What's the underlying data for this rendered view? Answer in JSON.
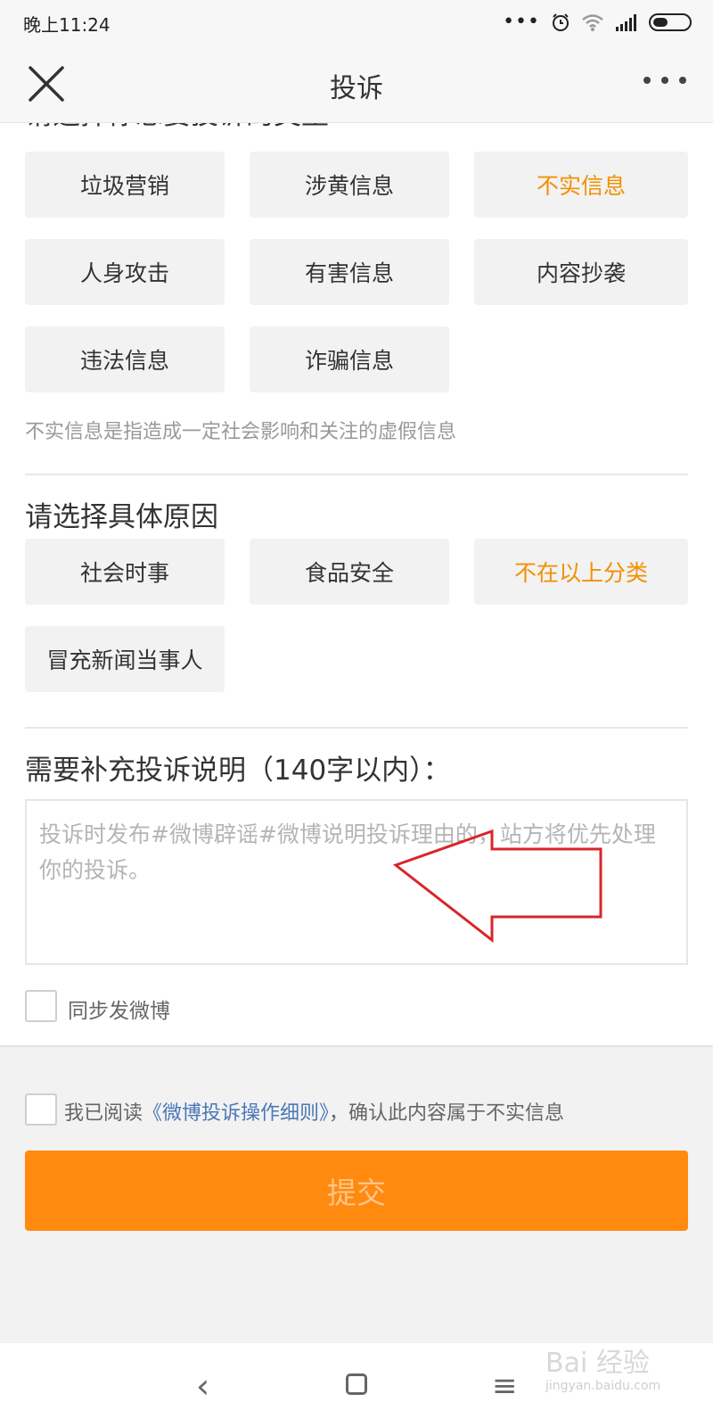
{
  "status_bar": {
    "time": "晚上11:24",
    "dots": "•••"
  },
  "nav": {
    "title": "投诉"
  },
  "clipped_heading": "请选择你想要投诉的类型",
  "complaint_types": [
    {
      "label": "垃圾营销",
      "selected": false
    },
    {
      "label": "涉黄信息",
      "selected": false
    },
    {
      "label": "不实信息",
      "selected": true
    },
    {
      "label": "人身攻击",
      "selected": false
    },
    {
      "label": "有害信息",
      "selected": false
    },
    {
      "label": "内容抄袭",
      "selected": false
    },
    {
      "label": "违法信息",
      "selected": false
    },
    {
      "label": "诈骗信息",
      "selected": false
    }
  ],
  "type_hint": "不实信息是指造成一定社会影响和关注的虚假信息",
  "reason_section": {
    "title": "请选择具体原因",
    "reasons": [
      {
        "label": "社会时事",
        "selected": false
      },
      {
        "label": "食品安全",
        "selected": false
      },
      {
        "label": "不在以上分类",
        "selected": true
      },
      {
        "label": "冒充新闻当事人",
        "selected": false
      }
    ]
  },
  "explanation": {
    "title": "需要补充投诉说明（140字以内）：",
    "placeholder": "投诉时发布#微博辟谣#微博说明投诉理由的，站方将优先处理你的投诉。"
  },
  "sync_checkbox_label": "同步发微博",
  "agreement": {
    "prefix": "我已阅读",
    "link": "《微博投诉操作细则》",
    "suffix": "，确认此内容属于不实信息"
  },
  "submit_label": "提交",
  "bottom_nav": {
    "back": "‹",
    "menu": "≡"
  },
  "watermark": {
    "main": "Bai 经验",
    "sub": "jingyan.baidu.com"
  },
  "colors": {
    "accent": "#f29000",
    "submit_bg": "#ff8a0f",
    "link": "#4a78b8",
    "arrow": "#d9252b"
  }
}
